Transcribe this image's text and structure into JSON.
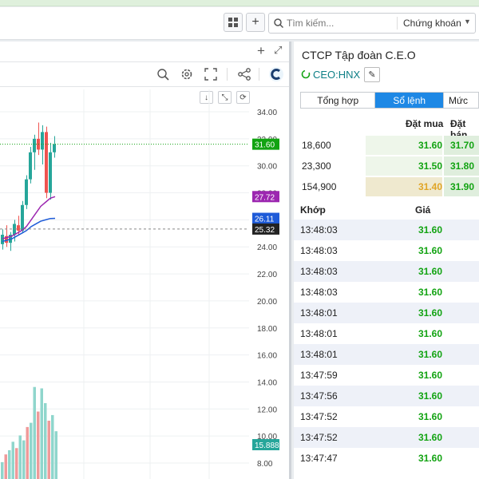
{
  "header": {
    "search_placeholder": "Tìm kiếm...",
    "search_scope": "Chứng khoán",
    "plus_label": "+"
  },
  "chart": {
    "y_ticks": [
      "34.00",
      "32.00",
      "30.00",
      "28.00",
      "26.00",
      "24.00",
      "22.00",
      "20.00",
      "18.00",
      "16.00",
      "14.00",
      "12.00",
      "10.00",
      "8.00"
    ],
    "price_labels": [
      {
        "text": "31.60",
        "bg": "#12a312",
        "color": "#ffffff"
      },
      {
        "text": "27.72",
        "bg": "#9c27b0",
        "color": "#ffffff"
      },
      {
        "text": "26.11",
        "bg": "#1e5bd8",
        "color": "#ffffff"
      },
      {
        "text": "25.32",
        "bg": "#222222",
        "color": "#ffffff"
      },
      {
        "text": "15.888M",
        "bg": "#26a69a",
        "color": "#ffffff"
      }
    ]
  },
  "chart_data": {
    "type": "candlestick",
    "ylim": [
      8,
      34
    ],
    "last_price": 31.6,
    "reference_price": 25.32,
    "ma_fast_last": 27.72,
    "ma_slow_last": 26.11,
    "volume_last": "15.888M",
    "candles": [
      {
        "o": 24.2,
        "h": 25.3,
        "l": 23.8,
        "c": 24.9
      },
      {
        "o": 24.8,
        "h": 25.6,
        "l": 24.0,
        "c": 24.3
      },
      {
        "o": 24.3,
        "h": 25.1,
        "l": 23.7,
        "c": 24.9
      },
      {
        "o": 24.9,
        "h": 26.0,
        "l": 24.4,
        "c": 25.7
      },
      {
        "o": 25.6,
        "h": 26.3,
        "l": 24.9,
        "c": 25.2
      },
      {
        "o": 25.2,
        "h": 27.4,
        "l": 25.0,
        "c": 27.1
      },
      {
        "o": 27.1,
        "h": 29.3,
        "l": 26.8,
        "c": 29.0
      },
      {
        "o": 29.0,
        "h": 31.4,
        "l": 28.7,
        "c": 31.0
      },
      {
        "o": 31.0,
        "h": 32.3,
        "l": 29.7,
        "c": 32.0
      },
      {
        "o": 32.0,
        "h": 33.2,
        "l": 30.8,
        "c": 31.2
      },
      {
        "o": 31.2,
        "h": 33.0,
        "l": 30.1,
        "c": 32.5
      },
      {
        "o": 32.5,
        "h": 32.9,
        "l": 27.6,
        "c": 28.0
      },
      {
        "o": 28.0,
        "h": 31.7,
        "l": 27.5,
        "c": 31.0
      },
      {
        "o": 31.0,
        "h": 32.2,
        "l": 30.6,
        "c": 31.6
      }
    ],
    "volumes": [
      2.4,
      3.5,
      4.1,
      5.3,
      4.4,
      6.2,
      5.5,
      7.4,
      8.0,
      13.1,
      9.6,
      12.9,
      10.8,
      8.3,
      9.1,
      6.8
    ]
  },
  "orderbook": {
    "company": "CTCP Tập đoàn C.E.O",
    "ticker": "CEO:HNX",
    "tabs": [
      "Tổng hợp",
      "Sổ lệnh",
      "Mức"
    ],
    "head_buy": "Đặt mua",
    "head_sell": "Đặt bán",
    "rows": [
      {
        "vol": "18,600",
        "buy": "31.60",
        "sell": "31.70"
      },
      {
        "vol": "23,300",
        "buy": "31.50",
        "sell": "31.80"
      },
      {
        "vol": "154,900",
        "buy": "31.40",
        "sell": "31.90"
      }
    ]
  },
  "trades": {
    "head_time": "Khớp",
    "head_price": "Giá",
    "rows": [
      {
        "time": "13:48:03",
        "price": "31.60"
      },
      {
        "time": "13:48:03",
        "price": "31.60"
      },
      {
        "time": "13:48:03",
        "price": "31.60"
      },
      {
        "time": "13:48:03",
        "price": "31.60"
      },
      {
        "time": "13:48:01",
        "price": "31.60"
      },
      {
        "time": "13:48:01",
        "price": "31.60"
      },
      {
        "time": "13:48:01",
        "price": "31.60"
      },
      {
        "time": "13:47:59",
        "price": "31.60"
      },
      {
        "time": "13:47:56",
        "price": "31.60"
      },
      {
        "time": "13:47:52",
        "price": "31.60"
      },
      {
        "time": "13:47:52",
        "price": "31.60"
      },
      {
        "time": "13:47:47",
        "price": "31.60"
      }
    ]
  }
}
